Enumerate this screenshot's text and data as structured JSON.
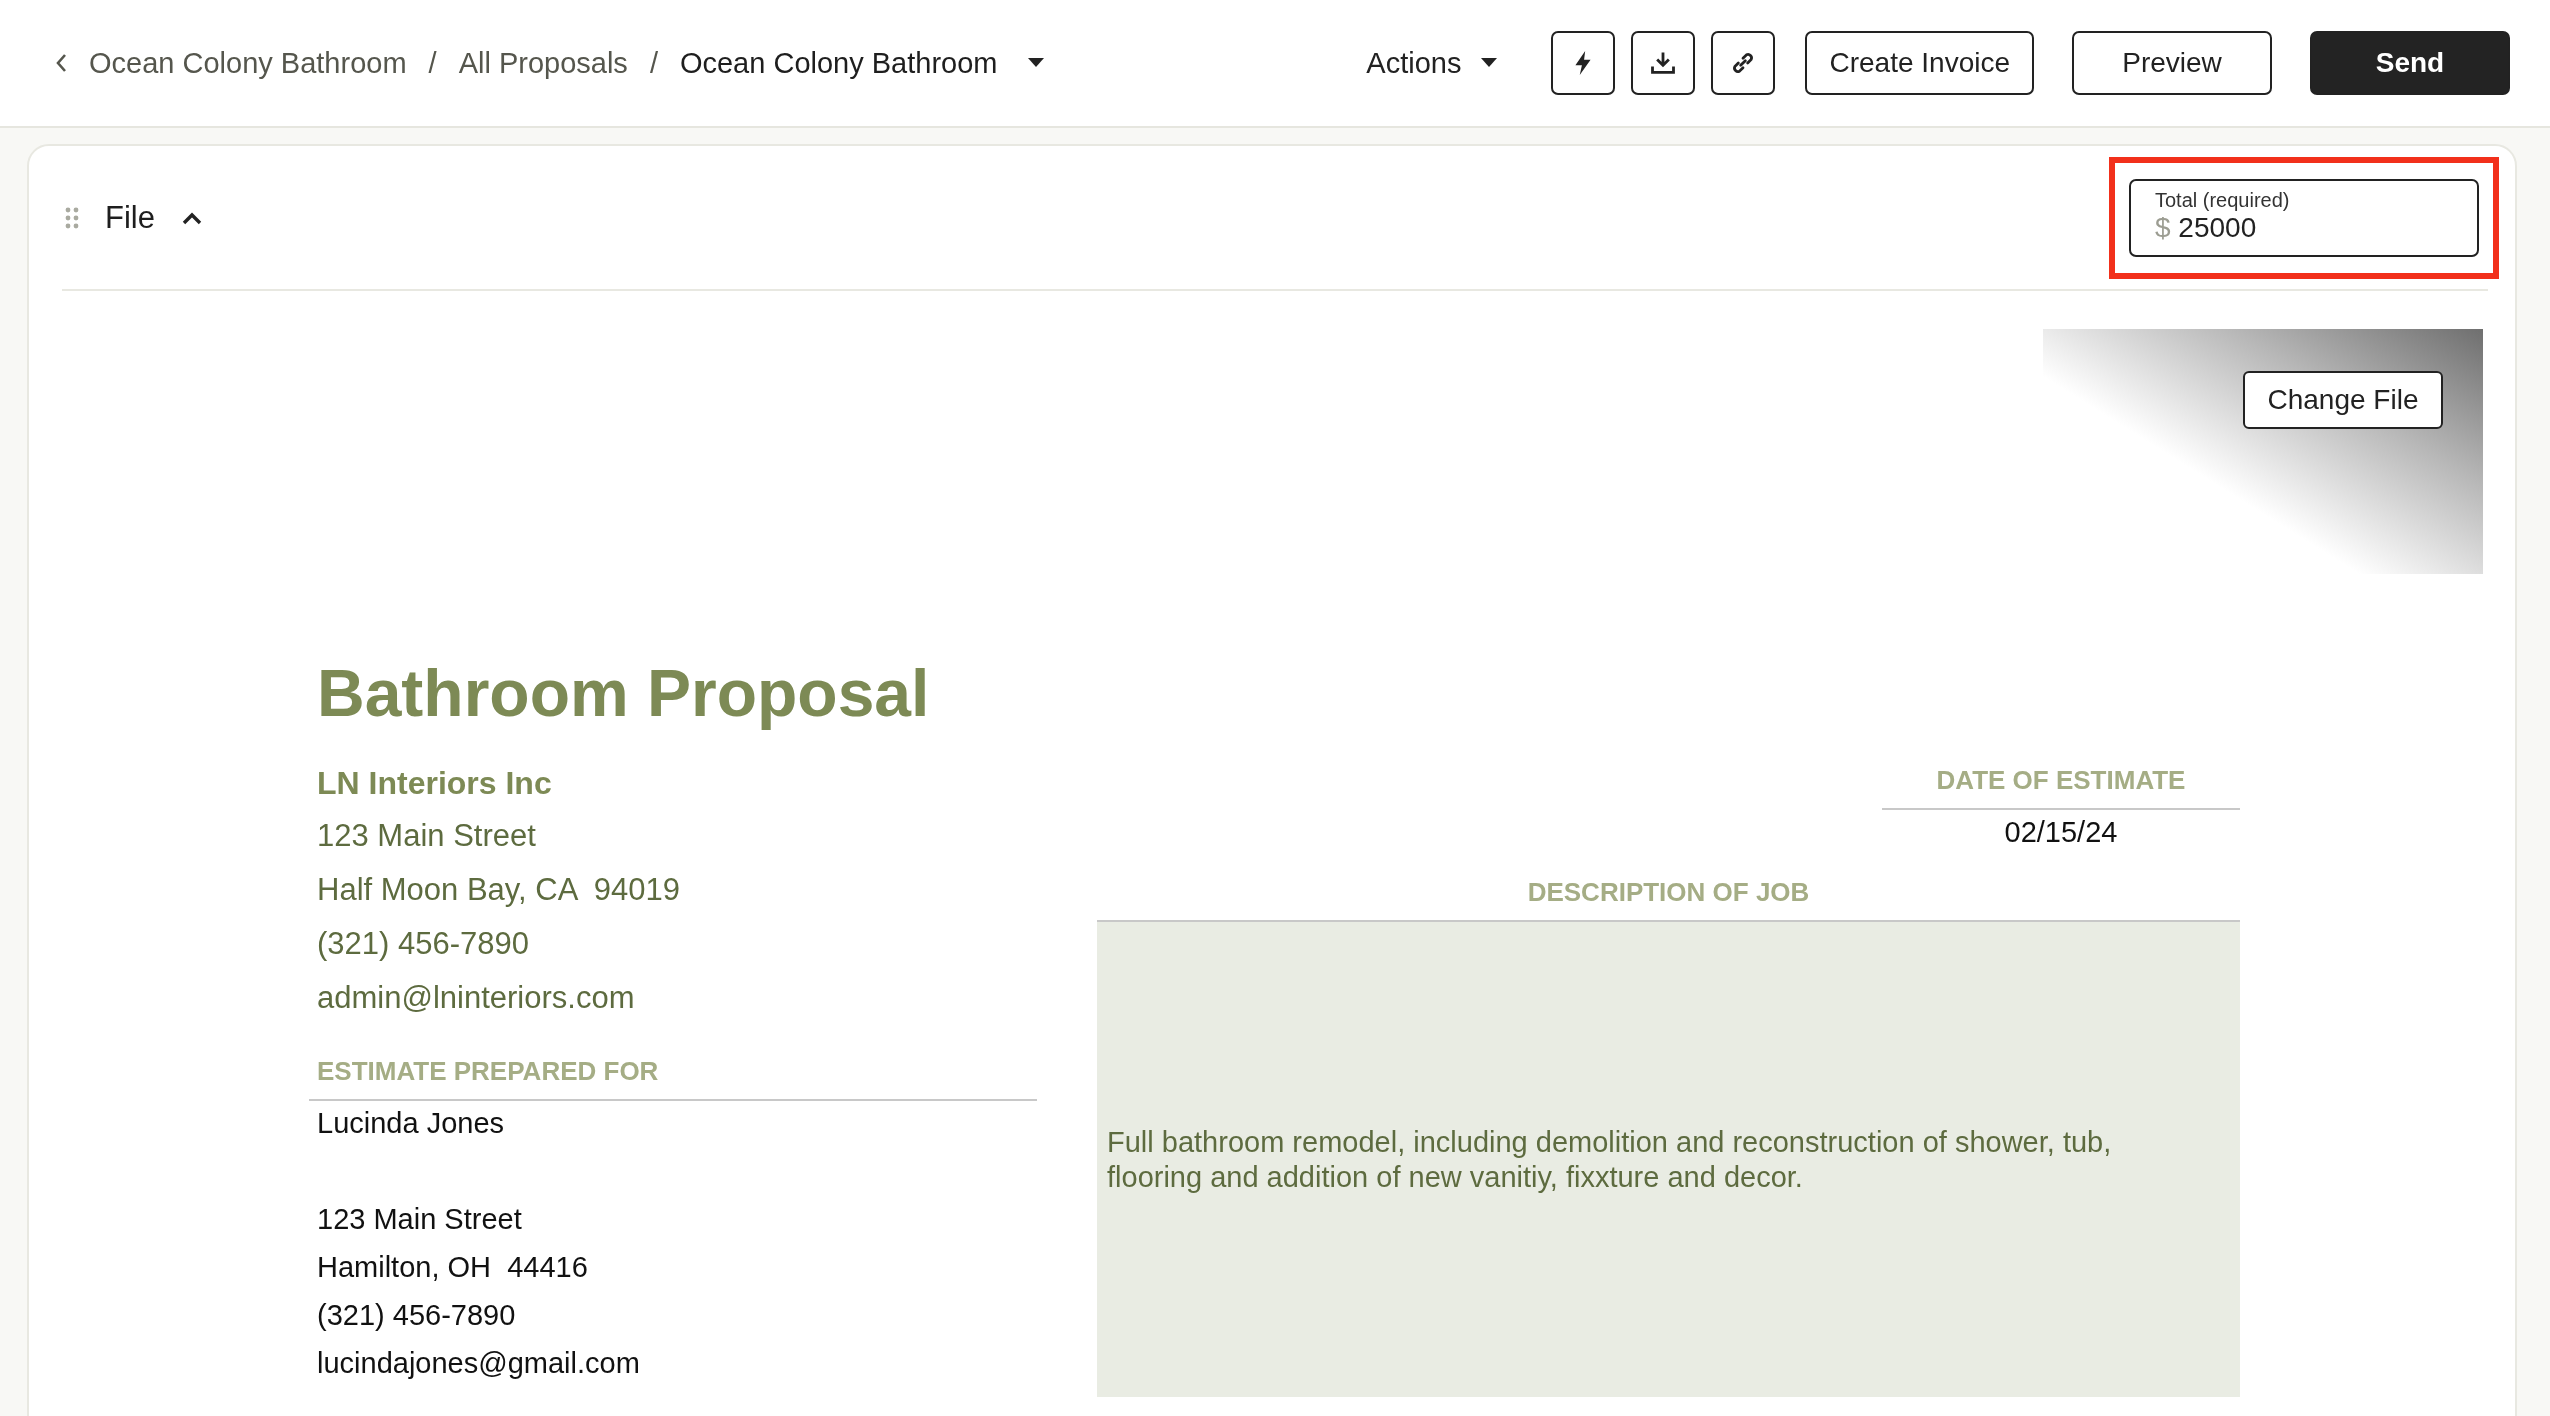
{
  "breadcrumb": {
    "items": [
      {
        "label": "Ocean Colony Bathroom",
        "current": false
      },
      {
        "separator": "/",
        "label": "All Proposals",
        "current": false
      },
      {
        "separator": "/",
        "label": "Ocean Colony Bathroom",
        "current": true
      }
    ]
  },
  "toolbar": {
    "actions_label": "Actions",
    "buttons": [
      {
        "label": "Create Invoice",
        "kind": "outline"
      },
      {
        "label": "Preview",
        "kind": "outline"
      },
      {
        "label": "Send",
        "kind": "primary"
      }
    ]
  },
  "section": {
    "title": "File",
    "expanded": true
  },
  "total": {
    "label": "Total (required)",
    "currency": "$",
    "value": "25000",
    "highlighted": true
  },
  "change_file_button": "Change File",
  "document": {
    "title": "Bathroom Proposal",
    "company": {
      "name": "LN Interiors Inc",
      "lines": [
        "123 Main Street",
        "Half Moon Bay, CA  94019",
        "(321) 456-7890",
        "admin@lninteriors.com"
      ]
    },
    "prepared_for": {
      "heading": "ESTIMATE PREPARED FOR",
      "name": "Lucinda Jones",
      "lines": [
        "123 Main Street",
        "Hamilton, OH  44416",
        "(321) 456-7890",
        "lucindajones@gmail.com"
      ]
    },
    "date": {
      "heading": "DATE OF ESTIMATE",
      "value": "02/15/24"
    },
    "description": {
      "heading": "DESCRIPTION OF JOB",
      "text": "Full bathroom remodel, including demolition and reconstruction of shower, tub, flooring and addition of new vanitiy, fixxture and decor."
    }
  }
}
